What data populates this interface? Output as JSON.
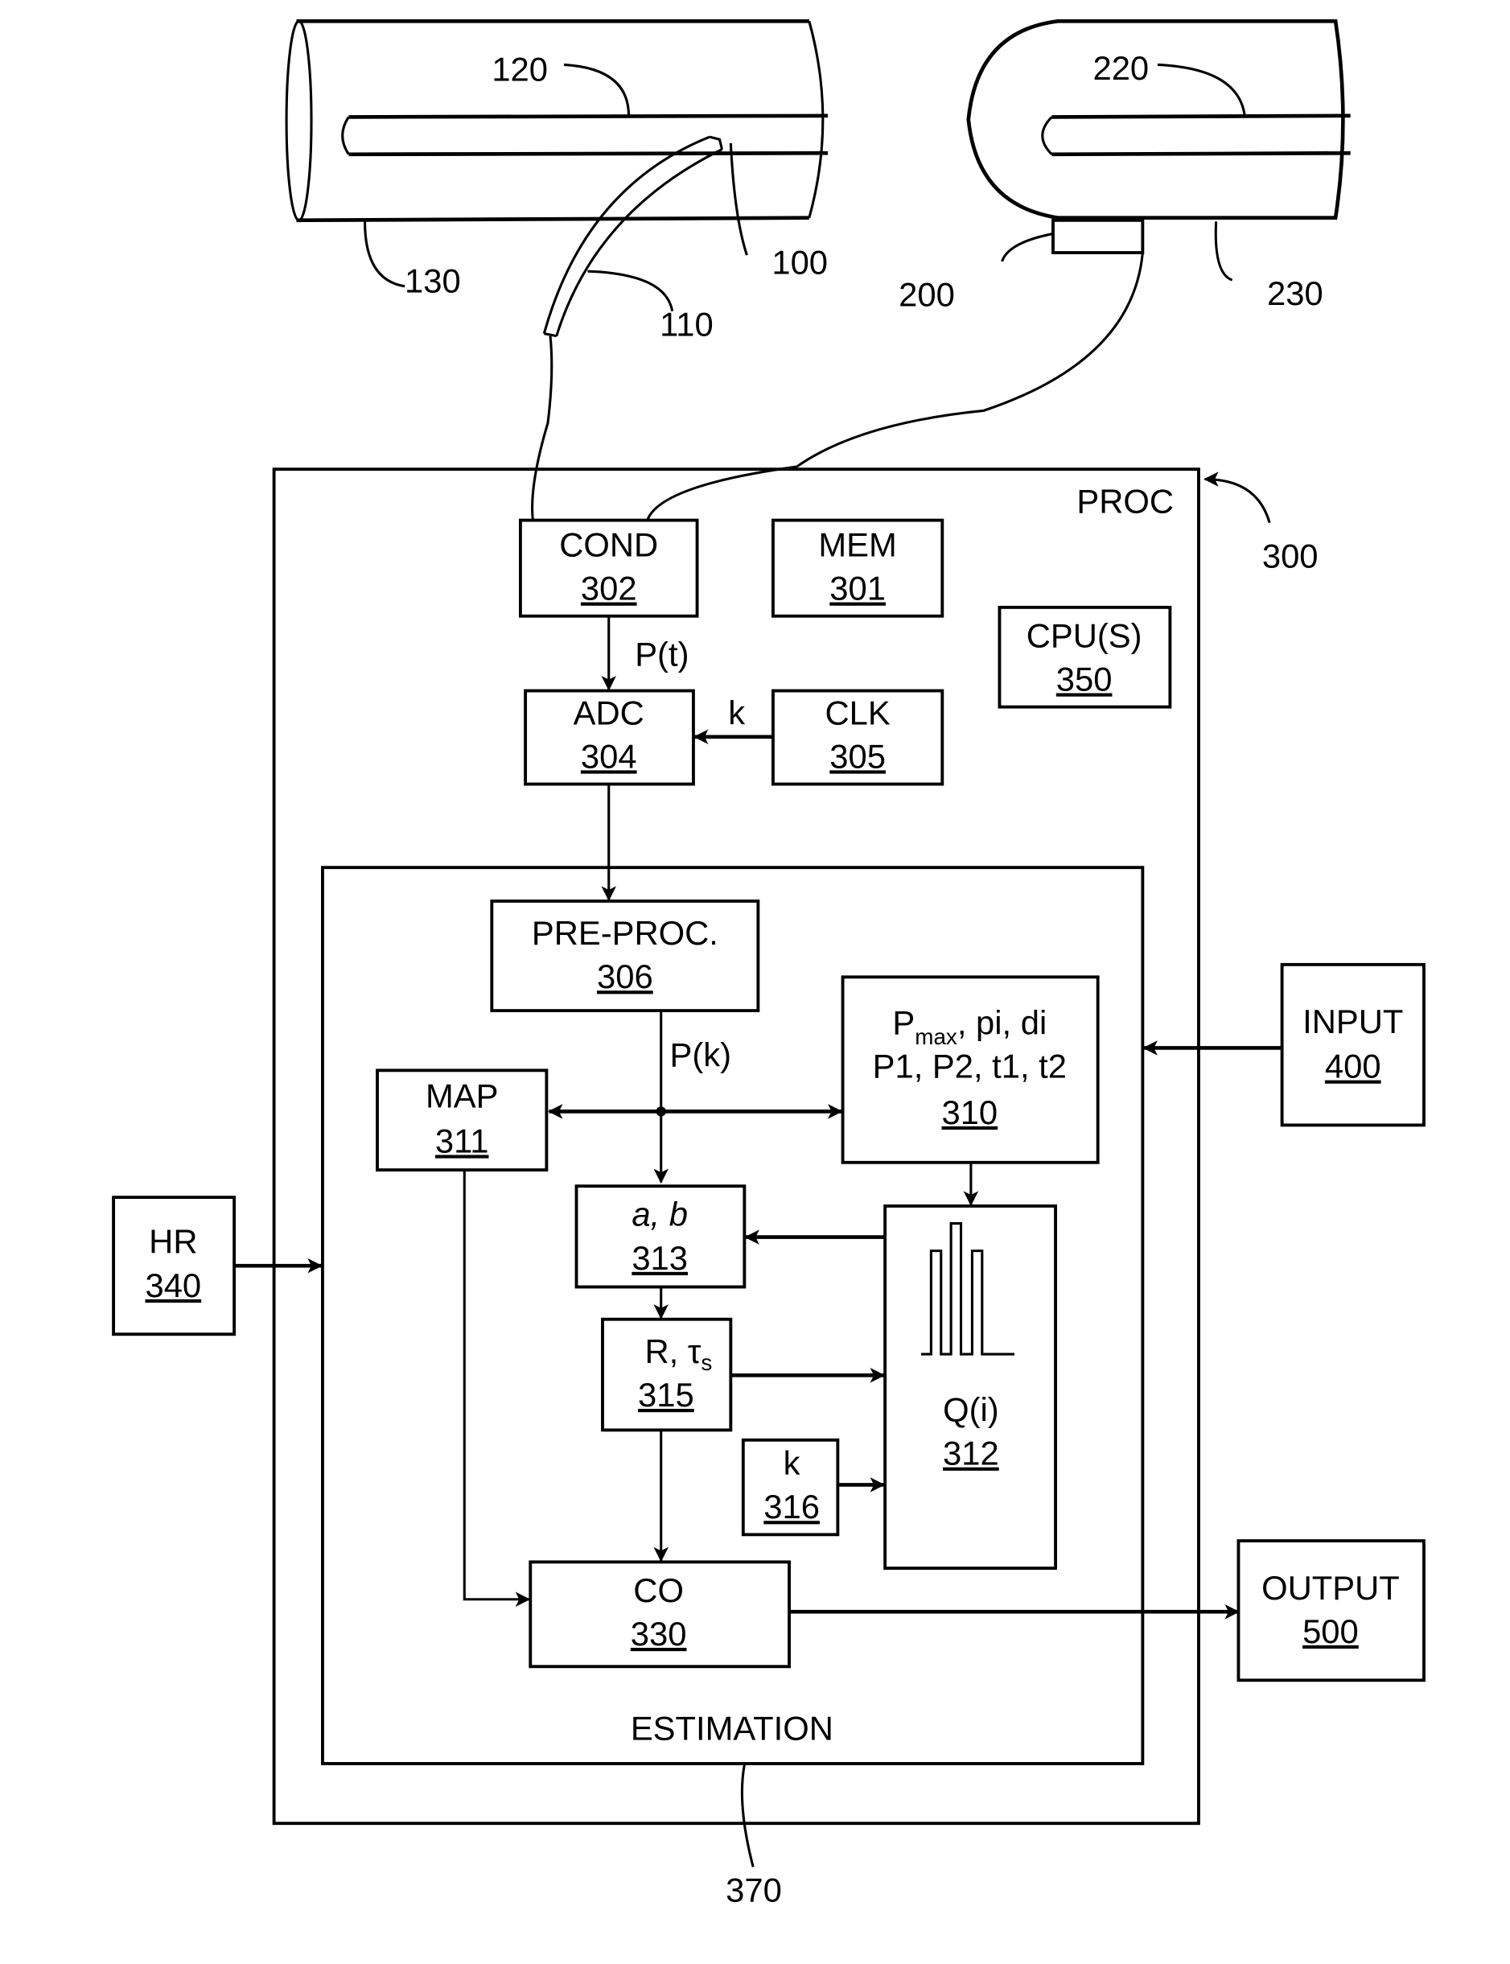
{
  "figure": {
    "references": {
      "r100": "100",
      "r110": "110",
      "r120": "120",
      "r130": "130",
      "r200": "200",
      "r220": "220",
      "r230": "230",
      "r300": "300",
      "r370": "370"
    },
    "proc_label": "PROC",
    "estimation_label": "ESTIMATION",
    "blocks": {
      "cond": {
        "label": "COND",
        "num": "302"
      },
      "mem": {
        "label": "MEM",
        "num": "301"
      },
      "cpu": {
        "label": "CPU(S)",
        "num": "350"
      },
      "adc": {
        "label": "ADC",
        "num": "304"
      },
      "clk": {
        "label": "CLK",
        "num": "305"
      },
      "preproc": {
        "label": "PRE-PROC.",
        "num": "306"
      },
      "params": {
        "line1_p": "P",
        "line1_sub": "max",
        "line1_rest": ", pi, di",
        "line2": "P1, P2, t1, t2",
        "num": "310"
      },
      "map": {
        "label": "MAP",
        "num": "311"
      },
      "ab": {
        "label": "a, b",
        "num": "313"
      },
      "rtau": {
        "label": "R, τ",
        "sub": "s",
        "num": "315"
      },
      "k": {
        "label": "k",
        "num": "316"
      },
      "qi": {
        "label": "Q(i)",
        "num": "312"
      },
      "co": {
        "label": "CO",
        "num": "330"
      },
      "hr": {
        "label": "HR",
        "num": "340"
      },
      "input": {
        "label": "INPUT",
        "num": "400"
      },
      "output": {
        "label": "OUTPUT",
        "num": "500"
      }
    },
    "signals": {
      "pt": "P(t)",
      "k": "k",
      "pk": "P(k)"
    }
  }
}
